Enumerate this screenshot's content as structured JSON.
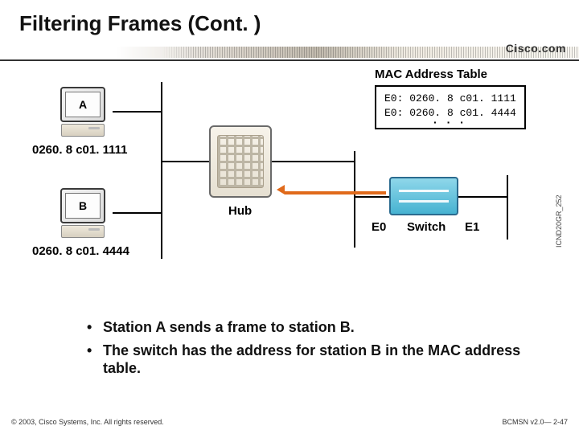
{
  "title": "Filtering Frames (Cont. )",
  "brand": "Cisco.com",
  "mac_table": {
    "title": "MAC Address Table",
    "rows": [
      "E0: 0260. 8 c01. 1111",
      "E0: 0260. 8 c01. 4444"
    ]
  },
  "stations": {
    "a": {
      "letter": "A",
      "mac": "0260. 8 c01. 1111"
    },
    "b": {
      "letter": "B",
      "mac": "0260. 8 c01. 4444"
    }
  },
  "devices": {
    "hub_label": "Hub",
    "switch_label": "Switch",
    "switch_ports": {
      "left": "E0",
      "right": "E1"
    }
  },
  "side_ref": "ICND20GR_252",
  "bullets": [
    "Station A sends a frame to station B.",
    "The switch has the address for station B in the MAC address table."
  ],
  "footer": {
    "left": "© 2003, Cisco Systems, Inc. All rights reserved.",
    "right": "BCMSN v2.0— 2-47"
  }
}
